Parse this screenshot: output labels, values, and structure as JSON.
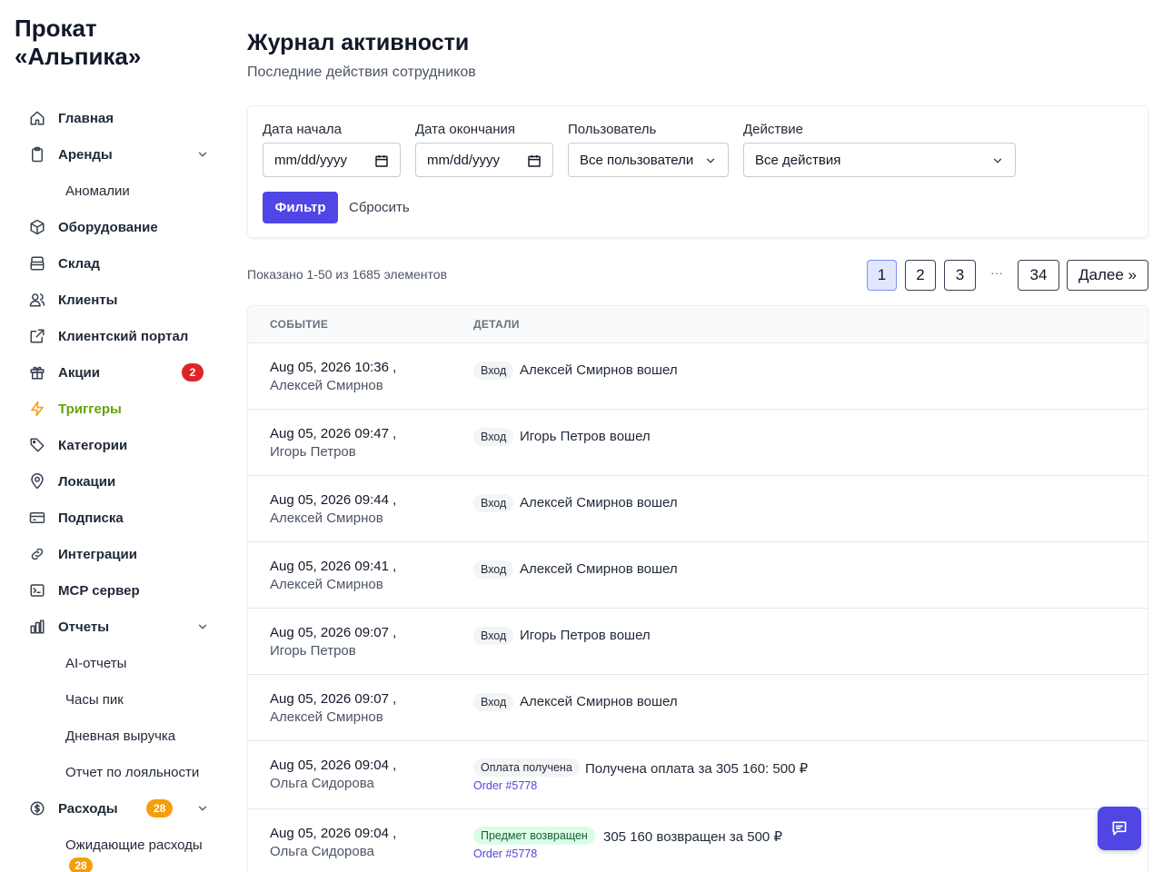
{
  "brand": {
    "name": "Прокат\n«Альпика»"
  },
  "sidebar": {
    "items": [
      {
        "label": "Главная",
        "icon": "home-icon"
      },
      {
        "label": "Аренды",
        "icon": "clipboard-icon",
        "expanded": true
      },
      {
        "label": "Аномалии",
        "sub": true
      },
      {
        "label": "Оборудование",
        "icon": "cube-icon"
      },
      {
        "label": "Склад",
        "icon": "warehouse-icon"
      },
      {
        "label": "Клиенты",
        "icon": "users-icon"
      },
      {
        "label": "Клиентский портал",
        "icon": "external-link-icon"
      },
      {
        "label": "Акции",
        "icon": "gift-icon",
        "badge": "2"
      },
      {
        "label": "Триггеры",
        "icon": "bolt-icon",
        "active": true
      },
      {
        "label": "Категории",
        "icon": "tag-icon"
      },
      {
        "label": "Локации",
        "icon": "map-pin-icon"
      },
      {
        "label": "Подписка",
        "icon": "credit-card-icon"
      },
      {
        "label": "Интеграции",
        "icon": "link-icon"
      },
      {
        "label": "MCP сервер",
        "icon": "terminal-icon"
      },
      {
        "label": "Отчеты",
        "icon": "chart-bar-icon",
        "expanded": true
      },
      {
        "label": "AI-отчеты",
        "sub": true
      },
      {
        "label": "Часы пик",
        "sub": true
      },
      {
        "label": "Дневная выручка",
        "sub": true
      },
      {
        "label": "Отчет по лояльности",
        "sub": true
      },
      {
        "label": "Расходы",
        "icon": "dollar-circle-icon",
        "badge": "28",
        "expanded": true
      },
      {
        "label": "Ожидающие расходы",
        "sub": true,
        "badge": "28"
      }
    ]
  },
  "header": {
    "title": "Журнал активности",
    "subtitle": "Последние действия сотрудников"
  },
  "filters": {
    "start_label": "Дата начала",
    "start_value": "mm/dd/yyyy",
    "end_label": "Дата окончания",
    "end_value": "mm/dd/yyyy",
    "user_label": "Пользователь",
    "user_value": "Все пользователи",
    "action_label": "Действие",
    "action_value": "Все действия",
    "filter_button": "Фильтр",
    "reset_button": "Сбросить"
  },
  "pagination": {
    "summary": "Показано 1-50 из 1685 элементов",
    "pages": [
      "1",
      "2",
      "3"
    ],
    "dots": "···",
    "last": "34",
    "next": "Далее »",
    "current": "1"
  },
  "table": {
    "headers": [
      "СОБЫТИЕ",
      "ДЕТАЛИ"
    ],
    "rows": [
      {
        "date": "Aug 05, 2026 10:36 ,",
        "user": "Алексей Смирнов",
        "tag": "Вход",
        "desc": "Алексей Смирнов вошел"
      },
      {
        "date": "Aug 05, 2026 09:47 ,",
        "user": "Игорь Петров",
        "tag": "Вход",
        "desc": "Игорь Петров вошел"
      },
      {
        "date": "Aug 05, 2026 09:44 ,",
        "user": "Алексей Смирнов",
        "tag": "Вход",
        "desc": "Алексей Смирнов вошел"
      },
      {
        "date": "Aug 05, 2026 09:41 ,",
        "user": "Алексей Смирнов",
        "tag": "Вход",
        "desc": "Алексей Смирнов вошел"
      },
      {
        "date": "Aug 05, 2026 09:07 ,",
        "user": "Игорь Петров",
        "tag": "Вход",
        "desc": "Игорь Петров вошел"
      },
      {
        "date": "Aug 05, 2026 09:07 ,",
        "user": "Алексей Смирнов",
        "tag": "Вход",
        "desc": "Алексей Смирнов вошел"
      },
      {
        "date": "Aug 05, 2026 09:04 ,",
        "user": "Ольга Сидорова",
        "tag": "Оплата получена",
        "desc": "Получена оплата за 305 160: 500 ₽",
        "order": "Order #5778"
      },
      {
        "date": "Aug 05, 2026 09:04 ,",
        "user": "Ольга Сидорова",
        "tag": "Предмет возвращен",
        "tag_color": "green",
        "desc": "305 160 возвращен за 500 ₽",
        "order": "Order #5778"
      }
    ]
  },
  "colors": {
    "accent": "#4f46e5",
    "active_nav": "#65a30d",
    "badge_red": "#dc2626",
    "badge_orange": "#f59e0b",
    "tag_green_bg": "#dcfce7"
  },
  "chat": {
    "icon": "chat-icon"
  }
}
